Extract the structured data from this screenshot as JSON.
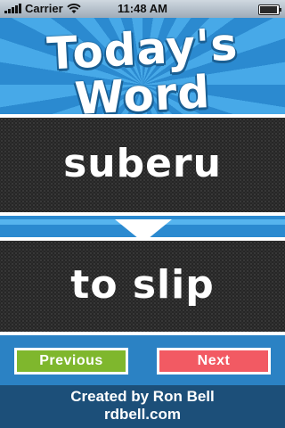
{
  "status_bar": {
    "carrier": "Carrier",
    "time": "11:48 AM",
    "signal_icon": "signal-bars-icon",
    "wifi_icon": "wifi-icon",
    "battery_icon": "battery-icon"
  },
  "header": {
    "title_line1": "Today's",
    "title_line2": "Word"
  },
  "word": {
    "term": "suberu",
    "meaning": "to slip",
    "arrow_icon": "down-arrow-icon"
  },
  "buttons": {
    "previous": "Previous",
    "next": "Next",
    "previous_color": "#7fb72d",
    "next_color": "#f25a63"
  },
  "footer": {
    "credit": "Created by Ron Bell",
    "website": "rdbell.com"
  }
}
